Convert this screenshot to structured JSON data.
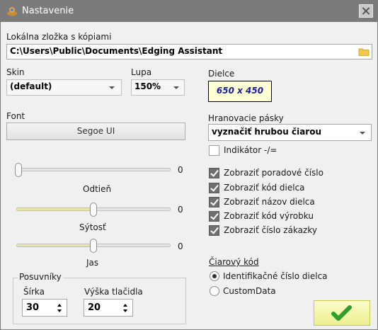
{
  "window": {
    "title": "Nastavenie",
    "close_icon": "close-icon"
  },
  "backup_folder": {
    "label": "Lokálna zložka s kópiami",
    "value": "C:\\Users\\Public\\Documents\\Edging Assistant"
  },
  "skin": {
    "label": "Skin",
    "value": "(default)"
  },
  "zoom": {
    "label": "Lupa",
    "value": "150%"
  },
  "font": {
    "label": "Font",
    "value": "Segoe UI"
  },
  "sliders": [
    {
      "label": "Odtieň",
      "value": "0",
      "level": 0.0
    },
    {
      "label": "Sýtosť",
      "value": "0",
      "level": 0.5
    },
    {
      "label": "Jas",
      "value": "0",
      "level": 0.5
    }
  ],
  "scrollbars": {
    "label": "Posuvníky",
    "width_label": "Šírka",
    "width_value": "30",
    "button_height_label": "Výška tlačidla",
    "button_height_value": "20"
  },
  "dielce": {
    "label": "Dielce",
    "preview": "650 x 450"
  },
  "edge_bands": {
    "label": "Hranovacie pásky",
    "value": "vyznačiť hrubou čiarou"
  },
  "checkboxes": [
    {
      "label": "Indikátor -/=",
      "checked": false
    },
    {
      "label": "Zobraziť poradové číslo",
      "checked": true
    },
    {
      "label": "Zobraziť kód dielca",
      "checked": true
    },
    {
      "label": "Zobraziť názov dielca",
      "checked": true
    },
    {
      "label": "Zobraziť kód výrobku",
      "checked": true
    },
    {
      "label": "Zobraziť číslo zákazky",
      "checked": true
    }
  ],
  "barcode": {
    "label": "Čiarový kód",
    "options": [
      {
        "label": "Identifikačné číslo dielca",
        "selected": true
      },
      {
        "label": "CustomData",
        "selected": false
      }
    ]
  },
  "ok_button": {
    "icon": "checkmark-icon",
    "color": "#2e9e2e"
  }
}
